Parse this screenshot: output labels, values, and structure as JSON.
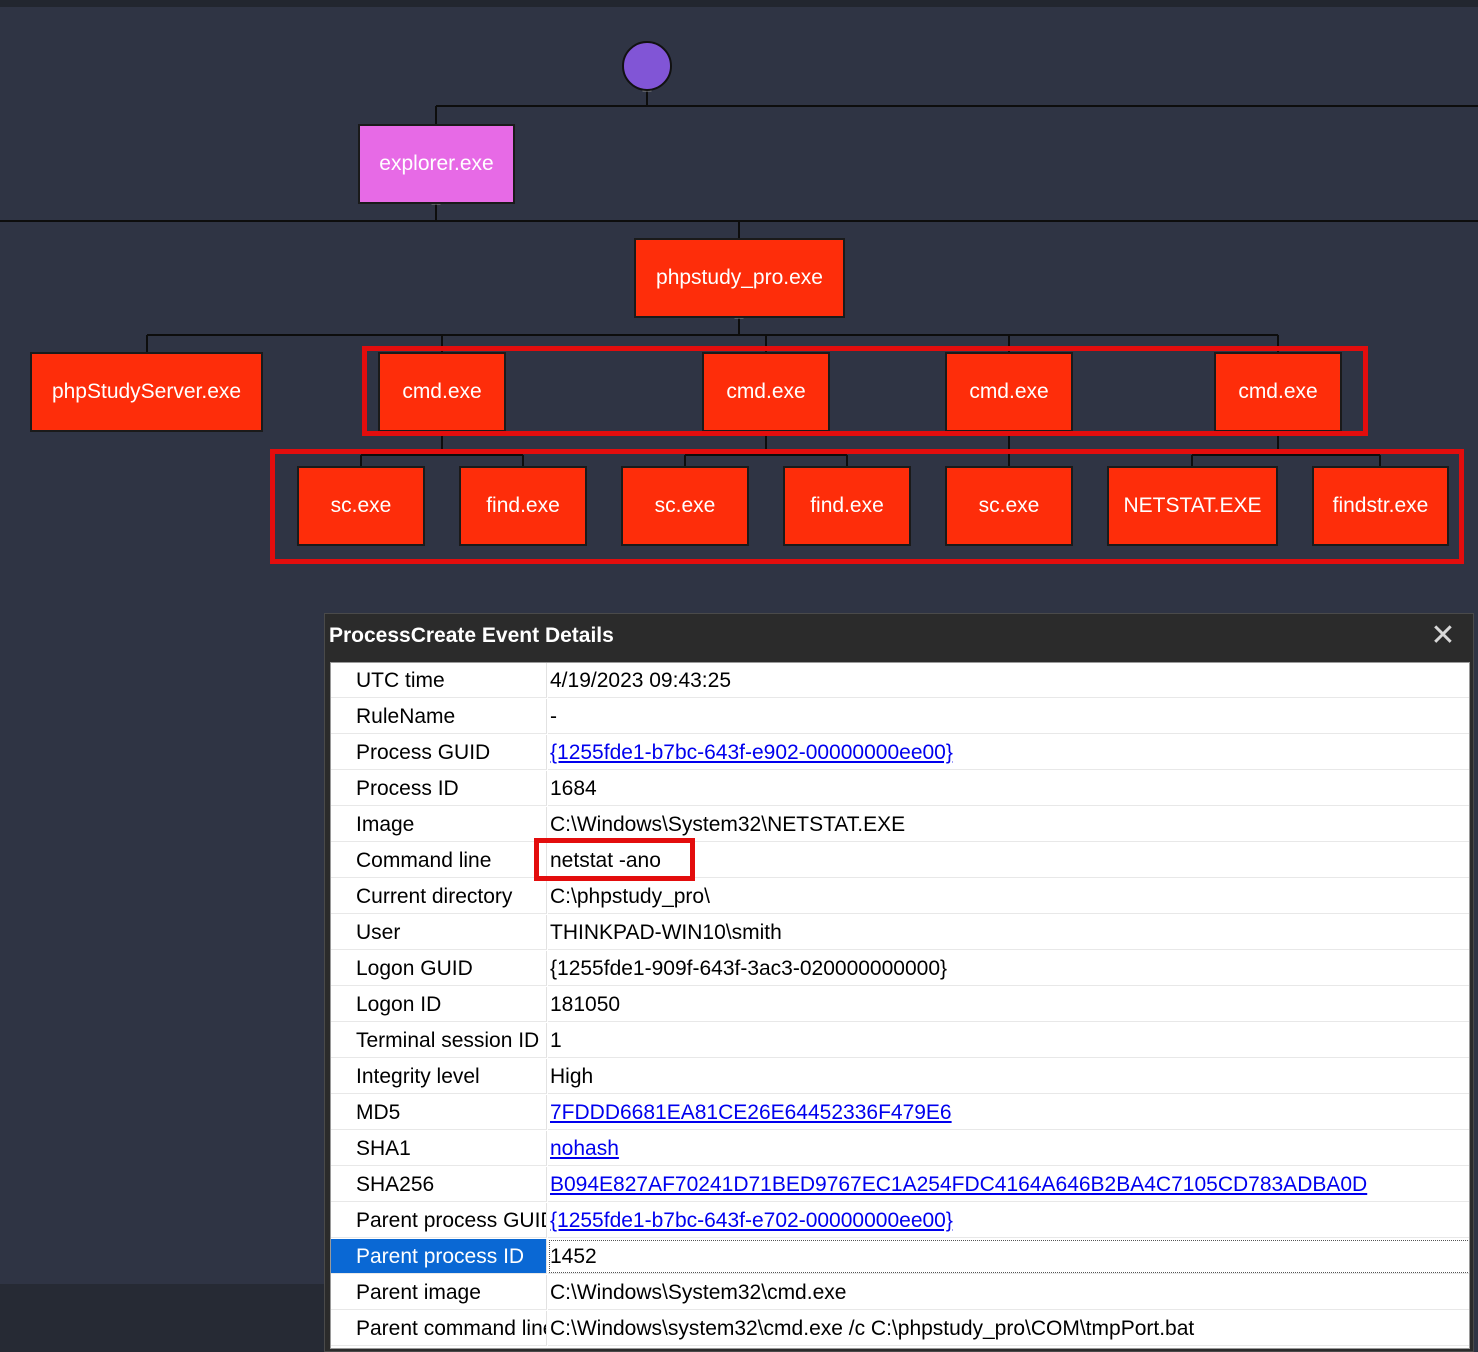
{
  "tree": {
    "root": "explorer.exe",
    "child": "phpstudy_pro.exe",
    "level2": [
      "phpStudyServer.exe",
      "cmd.exe",
      "cmd.exe",
      "cmd.exe",
      "cmd.exe"
    ],
    "level3": [
      "sc.exe",
      "find.exe",
      "sc.exe",
      "find.exe",
      "sc.exe",
      "NETSTAT.EXE",
      "findstr.exe"
    ]
  },
  "colors": {
    "node_red": "#fe2d0a",
    "node_pink": "#e76ae6",
    "root_circle": "#8155d6",
    "highlight": "#e30d0d",
    "selection": "#0a68d4",
    "link": "#0000ee"
  },
  "dialog": {
    "title": "ProcessCreate Event Details",
    "close_icon": "close-icon",
    "rows": [
      {
        "key": "UTC time",
        "value": "4/19/2023 09:43:25"
      },
      {
        "key": "RuleName",
        "value": "-"
      },
      {
        "key": "Process GUID",
        "value": "{1255fde1-b7bc-643f-e902-00000000ee00}",
        "link": true
      },
      {
        "key": "Process ID",
        "value": "1684"
      },
      {
        "key": "Image",
        "value": "C:\\Windows\\System32\\NETSTAT.EXE"
      },
      {
        "key": "Command line",
        "value": "netstat  -ano"
      },
      {
        "key": "Current directory",
        "value": "C:\\phpstudy_pro\\"
      },
      {
        "key": "User",
        "value": "THINKPAD-WIN10\\smith"
      },
      {
        "key": "Logon GUID",
        "value": "{1255fde1-909f-643f-3ac3-020000000000}"
      },
      {
        "key": "Logon ID",
        "value": "181050"
      },
      {
        "key": "Terminal session ID",
        "value": "1"
      },
      {
        "key": "Integrity level",
        "value": "High"
      },
      {
        "key": "MD5",
        "value": "7FDDD6681EA81CE26E64452336F479E6",
        "link": true
      },
      {
        "key": "SHA1",
        "value": "nohash",
        "link": true
      },
      {
        "key": "SHA256",
        "value": "B094E827AF70241D71BED9767EC1A254FDC4164A646B2BA4C7105CD783ADBA0D",
        "link": true
      },
      {
        "key": "Parent process GUID",
        "value": "{1255fde1-b7bc-643f-e702-00000000ee00}",
        "link": true
      },
      {
        "key": "Parent process ID",
        "value": "1452",
        "selected": true
      },
      {
        "key": "Parent image",
        "value": "C:\\Windows\\System32\\cmd.exe"
      },
      {
        "key": "Parent command line",
        "value": "C:\\Windows\\system32\\cmd.exe /c C:\\phpstudy_pro\\COM\\tmpPort.bat"
      }
    ]
  }
}
